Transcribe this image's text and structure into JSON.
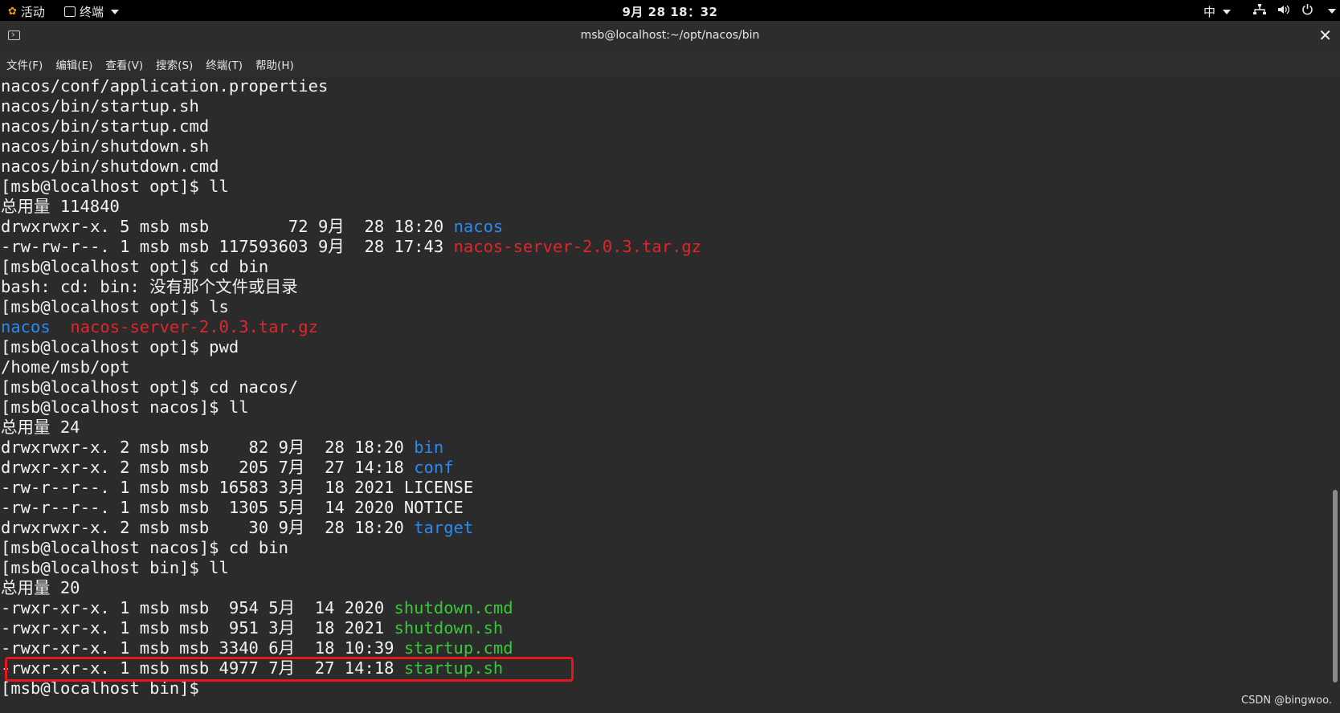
{
  "topbar": {
    "activities": "活动",
    "app_menu": "终端",
    "clock": "9月 28  18：32",
    "input_method": "中"
  },
  "window": {
    "title": "msb@localhost:~/opt/nacos/bin",
    "close": "✕"
  },
  "menubar": [
    "文件(F)",
    "编辑(E)",
    "查看(V)",
    "搜索(S)",
    "终端(T)",
    "帮助(H)"
  ],
  "terminal": {
    "lines": [
      [
        {
          "t": "nacos/conf/application.properties"
        }
      ],
      [
        {
          "t": "nacos/bin/startup.sh"
        }
      ],
      [
        {
          "t": "nacos/bin/startup.cmd"
        }
      ],
      [
        {
          "t": "nacos/bin/shutdown.sh"
        }
      ],
      [
        {
          "t": "nacos/bin/shutdown.cmd"
        }
      ],
      [
        {
          "t": "[msb@localhost opt]$ ll"
        }
      ],
      [
        {
          "t": "总用量 114840"
        }
      ],
      [
        {
          "t": "drwxrwxr-x. 5 msb msb        72 9月  28 18:20 "
        },
        {
          "t": "nacos",
          "c": "blue"
        }
      ],
      [
        {
          "t": "-rw-rw-r--. 1 msb msb 117593603 9月  28 17:43 "
        },
        {
          "t": "nacos-server-2.0.3.tar.gz",
          "c": "red"
        }
      ],
      [
        {
          "t": "[msb@localhost opt]$ cd bin"
        }
      ],
      [
        {
          "t": "bash: cd: bin: 没有那个文件或目录"
        }
      ],
      [
        {
          "t": "[msb@localhost opt]$ ls"
        }
      ],
      [
        {
          "t": "nacos",
          "c": "blue"
        },
        {
          "t": "  "
        },
        {
          "t": "nacos-server-2.0.3.tar.gz",
          "c": "red"
        }
      ],
      [
        {
          "t": "[msb@localhost opt]$ pwd"
        }
      ],
      [
        {
          "t": "/home/msb/opt"
        }
      ],
      [
        {
          "t": "[msb@localhost opt]$ cd nacos/"
        }
      ],
      [
        {
          "t": "[msb@localhost nacos]$ ll"
        }
      ],
      [
        {
          "t": "总用量 24"
        }
      ],
      [
        {
          "t": "drwxrwxr-x. 2 msb msb    82 9月  28 18:20 "
        },
        {
          "t": "bin",
          "c": "blue"
        }
      ],
      [
        {
          "t": "drwxr-xr-x. 2 msb msb   205 7月  27 14:18 "
        },
        {
          "t": "conf",
          "c": "blue"
        }
      ],
      [
        {
          "t": "-rw-r--r--. 1 msb msb 16583 3月  18 2021 LICENSE"
        }
      ],
      [
        {
          "t": "-rw-r--r--. 1 msb msb  1305 5月  14 2020 NOTICE"
        }
      ],
      [
        {
          "t": "drwxrwxr-x. 2 msb msb    30 9月  28 18:20 "
        },
        {
          "t": "target",
          "c": "blue"
        }
      ],
      [
        {
          "t": "[msb@localhost nacos]$ cd bin"
        }
      ],
      [
        {
          "t": "[msb@localhost bin]$ ll"
        }
      ],
      [
        {
          "t": "总用量 20"
        }
      ],
      [
        {
          "t": "-rwxr-xr-x. 1 msb msb  954 5月  14 2020 "
        },
        {
          "t": "shutdown.cmd",
          "c": "green"
        }
      ],
      [
        {
          "t": "-rwxr-xr-x. 1 msb msb  951 3月  18 2021 "
        },
        {
          "t": "shutdown.sh",
          "c": "green"
        }
      ],
      [
        {
          "t": "-rwxr-xr-x. 1 msb msb 3340 6月  18 10:39 "
        },
        {
          "t": "startup.cmd",
          "c": "green"
        }
      ],
      [
        {
          "t": "-rwxr-xr-x. 1 msb msb 4977 7月  27 14:18 "
        },
        {
          "t": "startup.sh",
          "c": "green"
        }
      ],
      [
        {
          "t": "[msb@localhost bin]$ "
        }
      ]
    ]
  },
  "watermark": "CSDN @bingwoo.",
  "colors": {
    "blue": "#2a8af4",
    "red": "#e0262b",
    "green": "#39c839",
    "highlight": "#e4171b"
  }
}
